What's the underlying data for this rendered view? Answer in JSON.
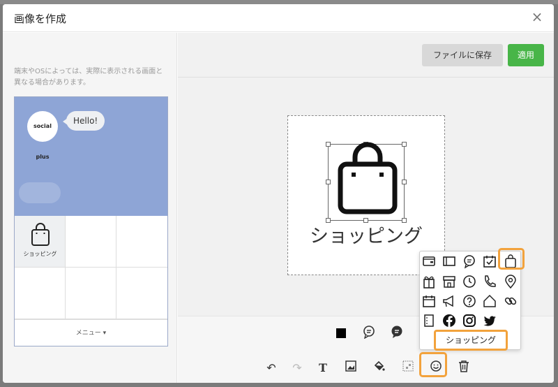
{
  "dialog": {
    "title": "画像を作成",
    "close_label": "×"
  },
  "preview": {
    "hint": "端末やOSによっては、実際に表示される画面と異なる場合があります。",
    "avatar_label": "social plus",
    "bubble_text": "Hello!",
    "cell_label": "ショッピング",
    "menu_label": "メニュー ▾"
  },
  "toolbar": {
    "save_file_label": "ファイルに保存",
    "apply_label": "適用"
  },
  "canvas": {
    "text": "ショッピング"
  },
  "icon_popup": {
    "selected_label": "ショッピング"
  },
  "tools": {
    "undo": "↶",
    "redo": "↷",
    "text": "T"
  },
  "colors": {
    "accent": "#48b548",
    "highlight": "#f2a23c"
  }
}
